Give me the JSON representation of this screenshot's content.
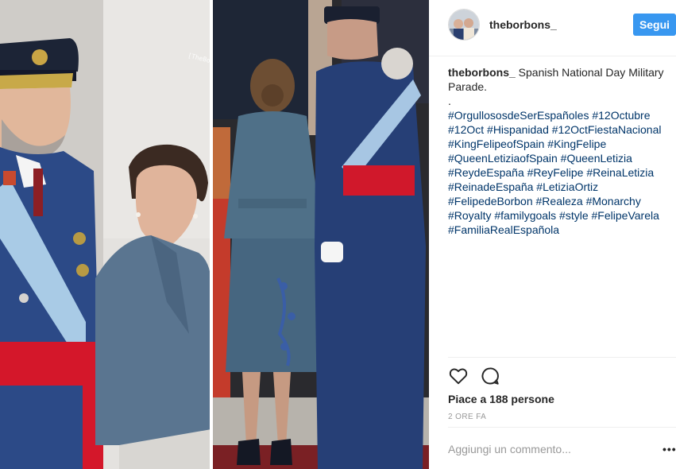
{
  "post": {
    "username": "theborbons_",
    "follow_label": "Segui",
    "photo_watermark": "[TheBorbons]",
    "caption_author": "theborbons_",
    "caption_text": "Spanish National Day Military Parade.",
    "caption_separator": ".",
    "hashtags": "#OrgullososdeSerEspañoles #12Octubre #12Oct #Hispanidad #12OctFiestaNacional #KingFelipeofSpain #KingFelipe #QueenLetiziaofSpain #QueenLetizia #ReydeEspaña #ReyFelipe #ReinaLetizia #ReinadeEspaña #LetiziaOrtiz #FelipedeBorbon #Realeza #Monarchy #Royalty #familygoals #style #FelipeVarela #FamiliaRealEspañola",
    "likes_label": "Piace a 188 persone",
    "timestamp": "2 ORE FA",
    "comment_placeholder": "Aggiungi un commento...",
    "more_label": "•••"
  },
  "icons": {
    "like": "heart-outline-icon",
    "comment": "speech-bubble-icon",
    "more": "more-options-icon"
  },
  "colors": {
    "follow_button": "#3897f0",
    "hashtag": "#003569",
    "muted": "#999999",
    "text": "#262626"
  }
}
